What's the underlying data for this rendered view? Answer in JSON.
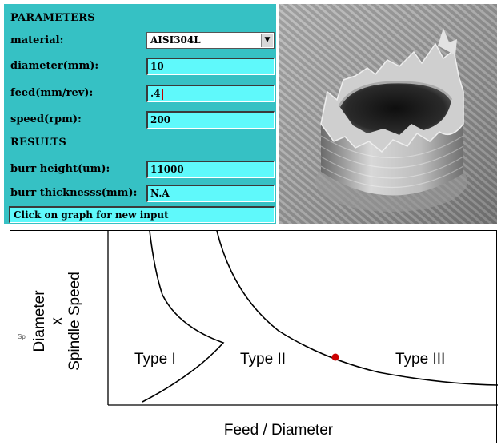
{
  "panel": {
    "parameters_heading": "PARAMETERS",
    "results_heading": "RESULTS",
    "material_label": "material:",
    "material_value": "AISI304L",
    "diameter_label": "diameter(mm):",
    "diameter_value": "10",
    "feed_label": "feed(mm/rev):",
    "feed_value": ".4",
    "speed_label": "speed(rpm):",
    "speed_value": "200",
    "burr_height_label": "burr height(um):",
    "burr_height_value": "11000",
    "burr_thickness_label": "burr thicknesss(mm):",
    "burr_thickness_value": "N.A",
    "status_text": "Click on graph for new input"
  },
  "graph": {
    "ylabel_line1": "Diameter",
    "ylabel_line2": "x",
    "ylabel_line3": "Spindle Speed",
    "xlabel": "Feed / Diameter",
    "small_label": "Spi",
    "region_1": "Type I",
    "region_2": "Type II",
    "region_3": "Type III",
    "marker_color": "#cc0000"
  },
  "colors": {
    "panel_bg": "#36c1c4",
    "field_bg": "#5ff9fb"
  }
}
